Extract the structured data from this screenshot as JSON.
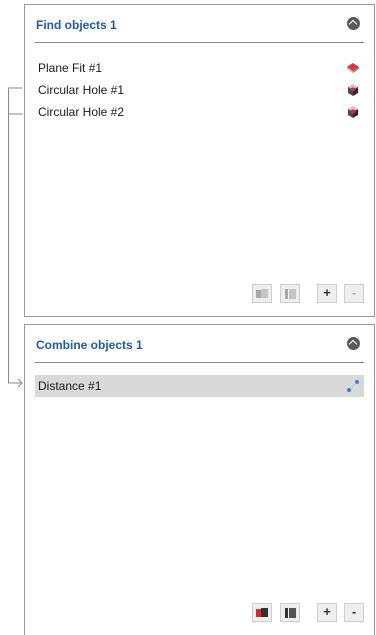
{
  "find_panel": {
    "title": "Find objects 1",
    "items": [
      {
        "label": "Plane Fit #1",
        "icon": "plane-fit-icon"
      },
      {
        "label": "Circular Hole #1",
        "icon": "circular-hole-icon"
      },
      {
        "label": "Circular Hole #2",
        "icon": "circular-hole-icon"
      }
    ],
    "toolbar": {
      "add_label": "+",
      "remove_label": "-",
      "icons": [
        "copy-objects-icon",
        "paste-objects-icon"
      ],
      "state": "disabled"
    }
  },
  "combine_panel": {
    "title": "Combine objects 1",
    "items": [
      {
        "label": "Distance #1",
        "icon": "distance-icon",
        "selected": true
      }
    ],
    "toolbar": {
      "add_label": "+",
      "remove_label": "-",
      "icons": [
        "copy-objects-icon",
        "paste-objects-icon"
      ],
      "state": "enabled"
    }
  },
  "colors": {
    "title": "#1e5ba8",
    "selection": "#d9d9d9",
    "border": "#9a9a9a"
  }
}
